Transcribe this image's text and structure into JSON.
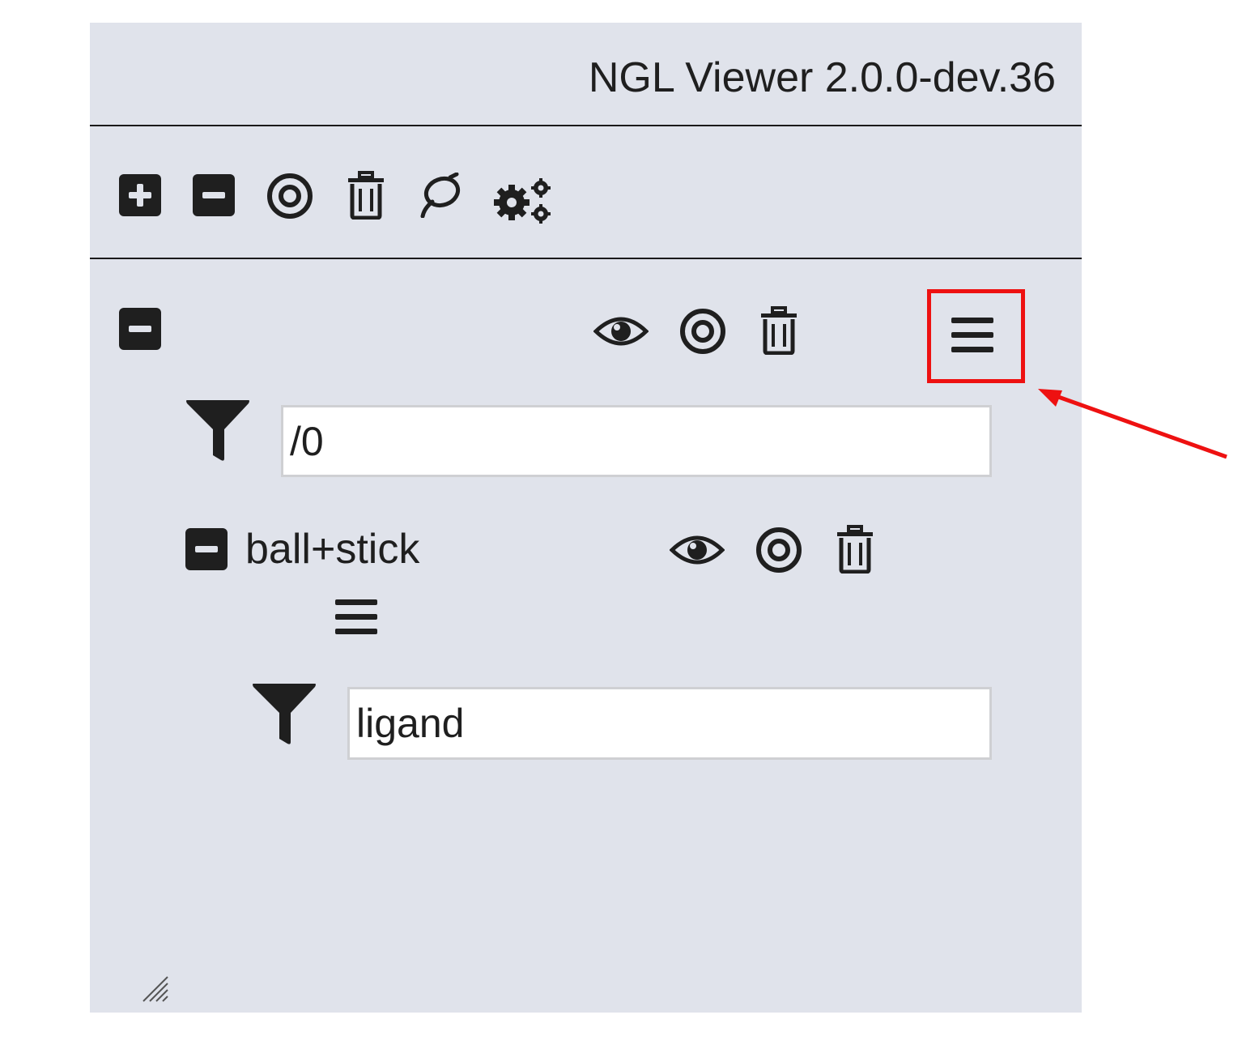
{
  "app": {
    "title": "NGL Viewer 2.0.0-dev.36"
  },
  "toolbar": {
    "icons": [
      "plus-square-icon",
      "minus-square-icon",
      "target-icon",
      "trash-icon",
      "lasso-icon",
      "cogs-icon"
    ]
  },
  "component": {
    "collapse_icon": "minus-square-icon",
    "actions": [
      "eye-icon",
      "target-icon",
      "trash-icon",
      "bars-icon"
    ],
    "filter": {
      "icon": "filter-icon",
      "value": "/0"
    },
    "representation": {
      "label": "ball+stick",
      "collapse_icon": "minus-square-icon",
      "actions": [
        "eye-icon",
        "target-icon",
        "trash-icon",
        "bars-icon"
      ],
      "filter": {
        "icon": "filter-icon",
        "value": "ligand"
      }
    }
  },
  "annotation": {
    "highlight": "menu-bars-button",
    "color": "#ee1111"
  },
  "colors": {
    "panel": "#e0e3eb",
    "icon": "#1f1f1f",
    "highlight": "#ee1111"
  }
}
